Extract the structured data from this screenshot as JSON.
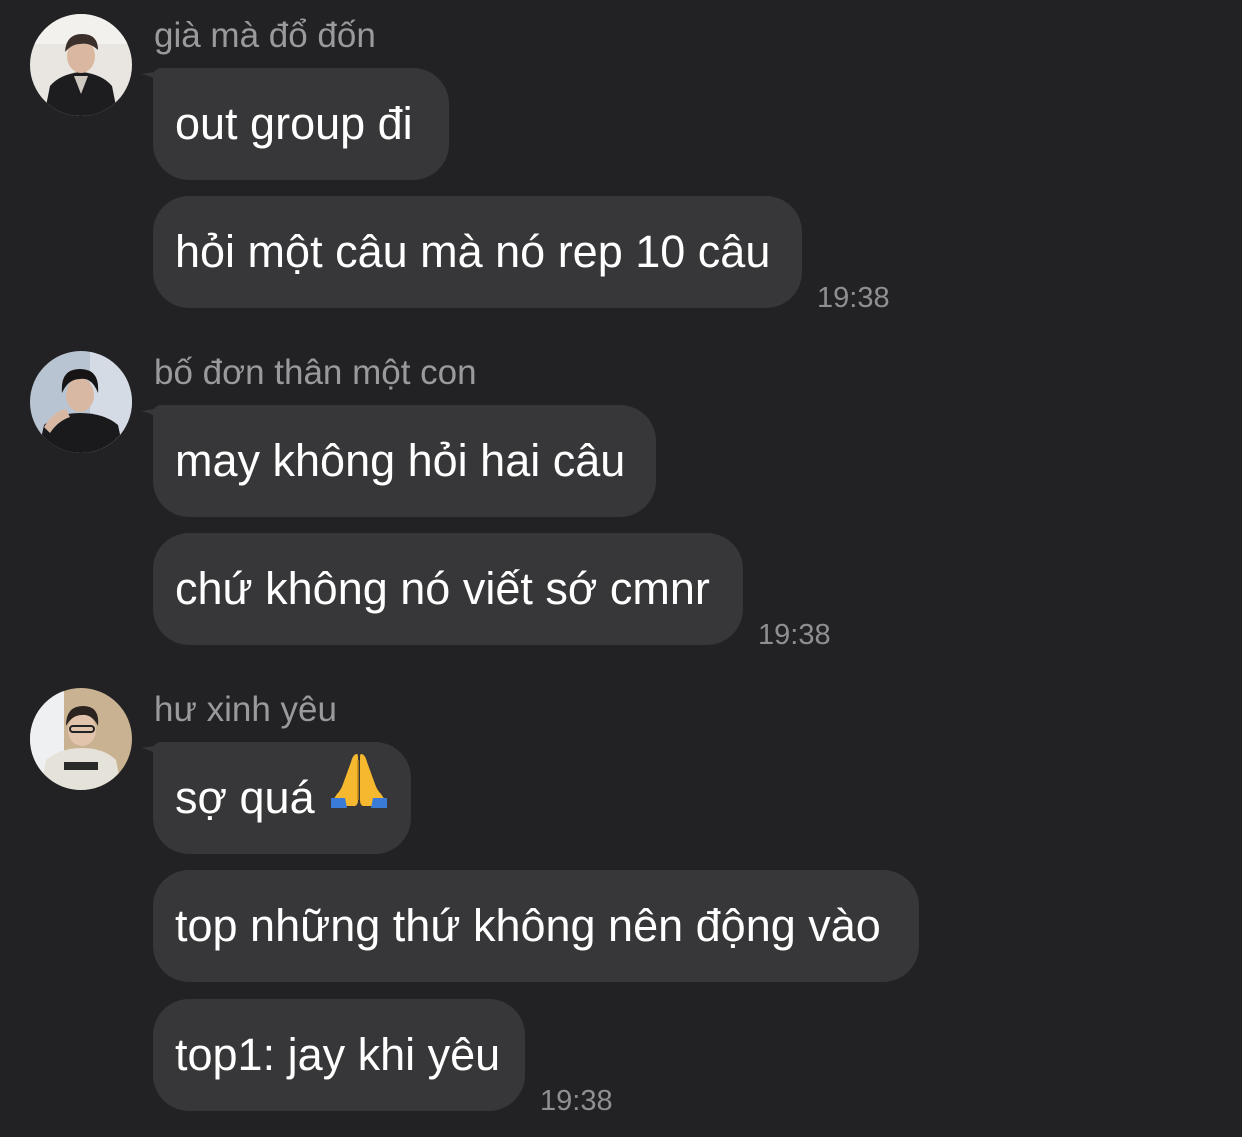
{
  "groups": [
    {
      "sender": "già mà đổ đốn",
      "messages": [
        "out group đi",
        "hỏi một câu mà nó rep 10 câu"
      ],
      "time": "19:38"
    },
    {
      "sender": "bố đơn thân một con",
      "messages": [
        "may không hỏi hai câu",
        "chứ không nó viết sớ cmnr"
      ],
      "time": "19:38"
    },
    {
      "sender": "hư xinh yêu",
      "messages": [
        "sợ quá",
        "top những thứ không nên động vào",
        "top1: jay khi yêu"
      ],
      "time": "19:38"
    }
  ],
  "icons": {
    "avatar_1": "user-avatar-photo",
    "avatar_2": "user-avatar-photo",
    "avatar_3": "user-avatar-photo",
    "emoji": "folded-hands-emoji"
  },
  "colors": {
    "background": "#222224",
    "bubble": "#373739",
    "sender_name": "#9a9a9e",
    "timestamp": "#8e8e93",
    "message_text": "#ffffff"
  }
}
